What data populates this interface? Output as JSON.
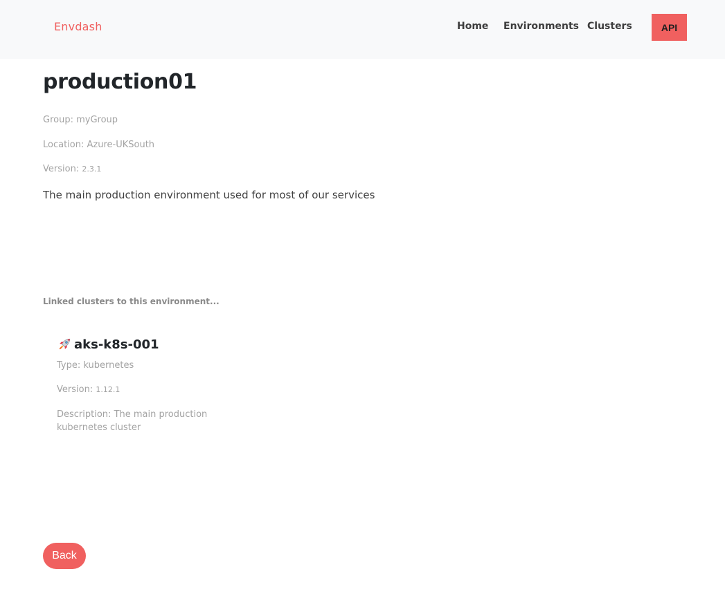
{
  "navbar": {
    "brand": "Envdash",
    "links": [
      "Home",
      "Environments",
      "Clusters"
    ],
    "api_label": "API"
  },
  "environment": {
    "name": "production01",
    "group_label": "Group: ",
    "group": "myGroup",
    "location_label": "Location: ",
    "location": "Azure-UKSouth",
    "version_label": "Version: ",
    "version": "2.3.1",
    "description": "The main production environment used for most of our services"
  },
  "linked_heading": "Linked clusters to this environment...",
  "clusters": [
    {
      "icon": "rocket-icon",
      "name": "aks-k8s-001",
      "type_label": "Type: ",
      "type": "kubernetes",
      "version_label": "Version: ",
      "version": "1.12.1",
      "description_label": "Description: ",
      "description": "The main production kubernetes cluster"
    }
  ],
  "back_label": "Back",
  "colors": {
    "accent": "#f0605f",
    "navbar_bg": "#f8f9fa",
    "muted_text": "#a3a3a3"
  }
}
